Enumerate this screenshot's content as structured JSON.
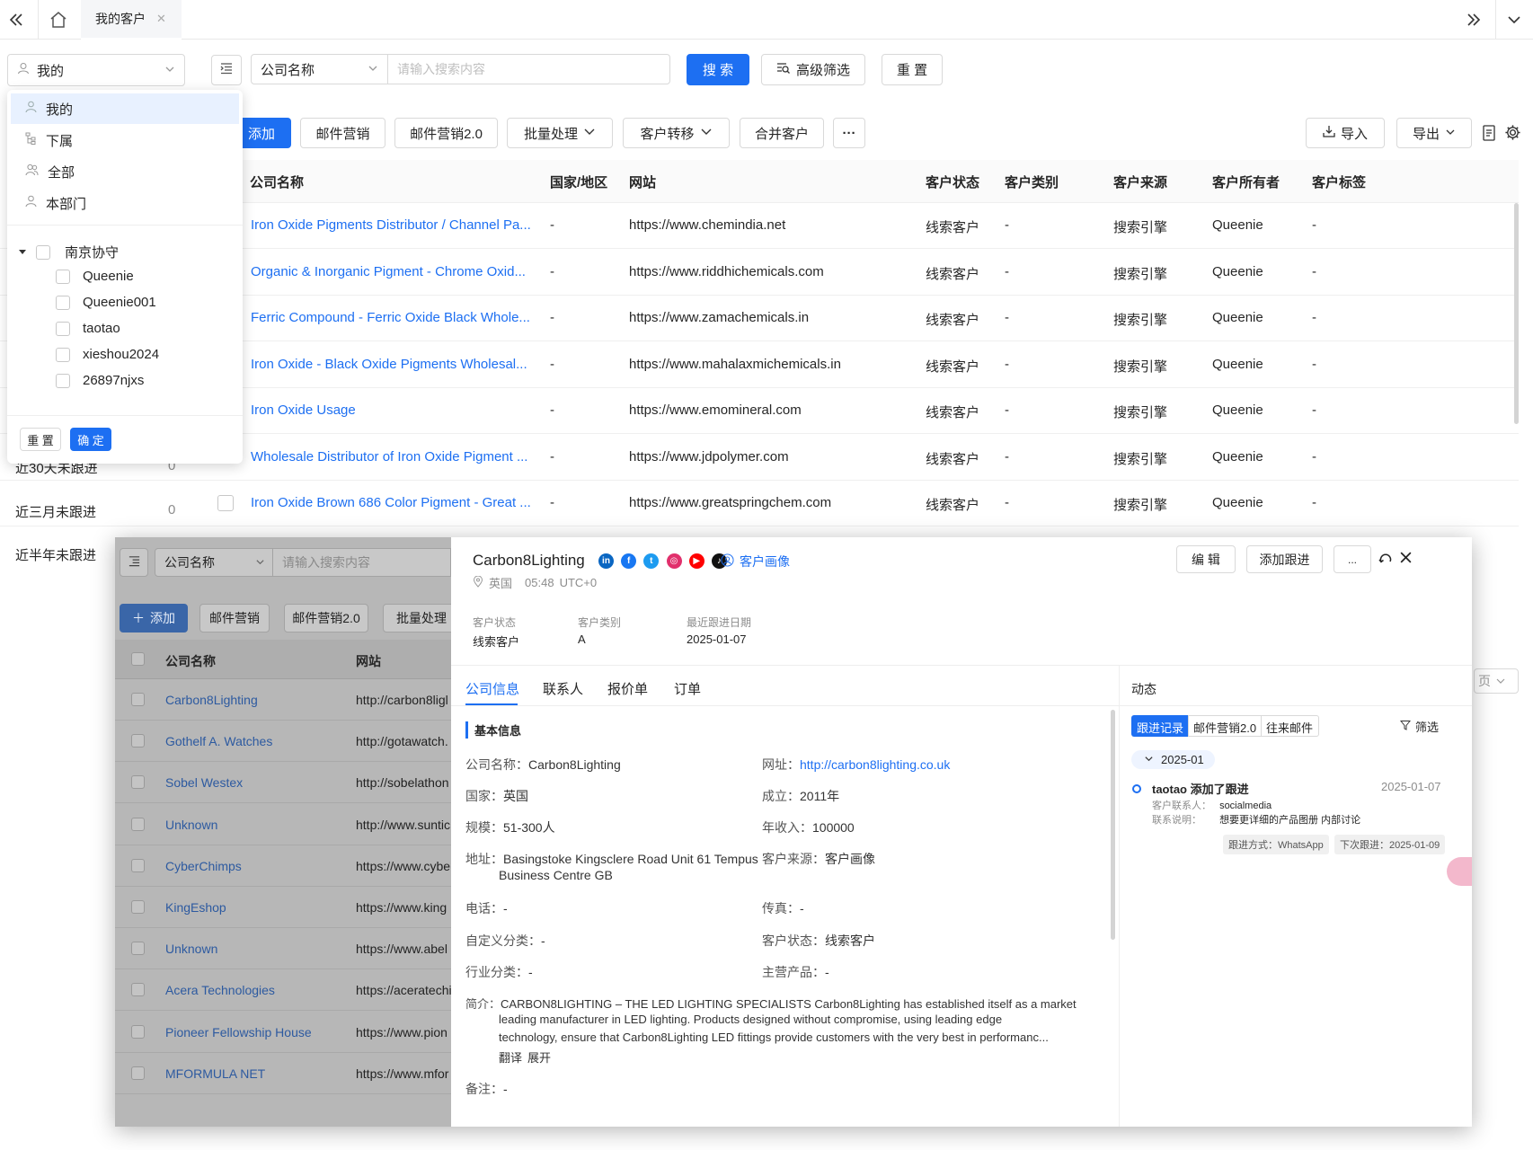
{
  "topbar": {
    "tab_label": "我的客户"
  },
  "filters": {
    "owner_select": "我的",
    "field_select": "公司名称",
    "search_placeholder": "请输入搜索内容",
    "search_btn": "搜 索",
    "advanced_btn": "高级筛选",
    "reset_btn": "重 置"
  },
  "toolbar": {
    "add": "添加",
    "mail": "邮件营销",
    "mail2": "邮件营销2.0",
    "batch": "批量处理",
    "transfer": "客户转移",
    "merge": "合并客户",
    "more": "···",
    "import": "导入",
    "export": "导出"
  },
  "table": {
    "columns": [
      "公司名称",
      "国家/地区",
      "网站",
      "客户状态",
      "客户类别",
      "客户来源",
      "客户所有者",
      "客户标签"
    ],
    "rows": [
      {
        "name": "Iron Oxide Pigments Distributor / Channel Pa...",
        "country": "-",
        "site": "https://www.chemindia.net",
        "status": "线索客户",
        "category": "-",
        "source": "搜索引擎",
        "owner": "Queenie",
        "tag": "-"
      },
      {
        "name": "Organic & Inorganic Pigment - Chrome Oxid...",
        "country": "-",
        "site": "https://www.riddhichemicals.com",
        "status": "线索客户",
        "category": "-",
        "source": "搜索引擎",
        "owner": "Queenie",
        "tag": "-"
      },
      {
        "name": "Ferric Compound - Ferric Oxide Black Whole...",
        "country": "-",
        "site": "https://www.zamachemicals.in",
        "status": "线索客户",
        "category": "-",
        "source": "搜索引擎",
        "owner": "Queenie",
        "tag": "-"
      },
      {
        "name": "Iron Oxide - Black Oxide Pigments Wholesal...",
        "country": "-",
        "site": "https://www.mahalaxmichemicals.in",
        "status": "线索客户",
        "category": "-",
        "source": "搜索引擎",
        "owner": "Queenie",
        "tag": "-"
      },
      {
        "name": "Iron Oxide Usage",
        "country": "-",
        "site": "https://www.emomineral.com",
        "status": "线索客户",
        "category": "-",
        "source": "搜索引擎",
        "owner": "Queenie",
        "tag": "-"
      },
      {
        "name": "Wholesale Distributor of Iron Oxide Pigment ...",
        "country": "-",
        "site": "https://www.jdpolymer.com",
        "status": "线索客户",
        "category": "-",
        "source": "搜索引擎",
        "owner": "Queenie",
        "tag": "-"
      },
      {
        "name": "Iron Oxide Brown 686 Color Pigment - Great ...",
        "country": "-",
        "site": "https://www.greatspringchem.com",
        "status": "线索客户",
        "category": "-",
        "source": "搜索引擎",
        "owner": "Queenie",
        "tag": "-"
      }
    ]
  },
  "side": {
    "items": [
      {
        "label": "近30天未跟进",
        "count": "0"
      },
      {
        "label": "近三月未跟进",
        "count": "0"
      },
      {
        "label": "近半年未跟进",
        "count": ""
      }
    ]
  },
  "dropdown": {
    "options": [
      "我的",
      "下属",
      "全部",
      "本部门"
    ],
    "group": "南京协守",
    "members": [
      "Queenie",
      "Queenie001",
      "taotao",
      "xieshou2024",
      "26897njxs"
    ],
    "reset": "重 置",
    "confirm": "确 定"
  },
  "overlay_left": {
    "field_select": "公司名称",
    "search_placeholder": "请输入搜索内容",
    "add": "添加",
    "mail": "邮件营销",
    "mail2": "邮件营销2.0",
    "batch": "批量处理",
    "col_name": "公司名称",
    "col_site": "网站",
    "rows": [
      {
        "name": "Carbon8Lighting",
        "site": "http://carbon8ligl"
      },
      {
        "name": "Gothelf A. Watches",
        "site": "http://gotawatch."
      },
      {
        "name": "Sobel Westex",
        "site": "http://sobelathon"
      },
      {
        "name": "Unknown",
        "site": "http://www.suntic"
      },
      {
        "name": "CyberChimps",
        "site": "https://www.cybe"
      },
      {
        "name": "KingEshop",
        "site": "https://www.king"
      },
      {
        "name": "Unknown",
        "site": "https://www.abel"
      },
      {
        "name": "Acera Technologies",
        "site": "https://aceratechi"
      },
      {
        "name": "Pioneer Fellowship House",
        "site": "https://www.pion"
      },
      {
        "name": "MFORMULA NET",
        "site": "https://www.mfor"
      }
    ]
  },
  "detail": {
    "company": "Carbon8Lighting",
    "portrait_link": "客户画像",
    "country": "英国",
    "time": "05:48",
    "tz": "UTC+0",
    "edit_btn": "编 辑",
    "follow_btn": "添加跟进",
    "more_btn": "...",
    "summary": [
      {
        "label": "客户状态",
        "value": "线索客户"
      },
      {
        "label": "客户类别",
        "value": "A"
      },
      {
        "label": "最近跟进日期",
        "value": "2025-01-07"
      }
    ],
    "tabs": [
      "公司信息",
      "联系人",
      "报价单",
      "订单"
    ],
    "section_title": "基本信息",
    "fields": {
      "company_k": "公司名称：",
      "company_v": "Carbon8Lighting",
      "site_k": "网址：",
      "site_v": "http://carbon8lighting.co.uk",
      "country_k": "国家：",
      "country_v": "英国",
      "founded_k": "成立：",
      "founded_v": "2011年",
      "scale_k": "规模：",
      "scale_v": "51-300人",
      "revenue_k": "年收入：",
      "revenue_v": "100000",
      "addr_k": "地址：",
      "addr_v1": "Basingstoke Kingsclere Road Unit 61 Tempus",
      "addr_v2": "Business Centre GB",
      "source_k": "客户来源：",
      "source_v": "客户画像",
      "phone_k": "电话：",
      "phone_v": "-",
      "fax_k": "传真：",
      "fax_v": "-",
      "custom_k": "自定义分类：",
      "custom_v": "-",
      "status_k": "客户状态：",
      "status_v": "线索客户",
      "industry_k": "行业分类：",
      "industry_v": "-",
      "product_k": "主营产品：",
      "product_v": "-",
      "intro_k": "简介：",
      "intro_l1": "CARBON8LIGHTING – THE LED LIGHTING SPECIALISTS Carbon8Lighting has established itself as a market",
      "intro_l2": "leading manufacturer in LED lighting. Products designed without compromise, using leading edge",
      "intro_l3": "technology, ensure that Carbon8Lighting LED fittings provide customers with the very best in performanc...",
      "translate": "翻译",
      "expand": "展开",
      "remark_k": "备注：",
      "remark_v": "-"
    },
    "activity": {
      "title": "动态",
      "tabs": [
        "跟进记录",
        "邮件营销2.0",
        "往来邮件"
      ],
      "filter": "筛选",
      "month": "2025-01",
      "entry_title": "taotao 添加了跟进",
      "entry_date": "2025-01-07",
      "contact_k": "客户联系人：",
      "contact_v": "socialmedia",
      "note_k": "联系说明：",
      "note_v": "想要更详细的产品图册 内部讨论",
      "method": "跟进方式：WhatsApp",
      "next": "下次跟进：2025-01-09"
    }
  },
  "right_fragment": {
    "page_label": "页"
  }
}
